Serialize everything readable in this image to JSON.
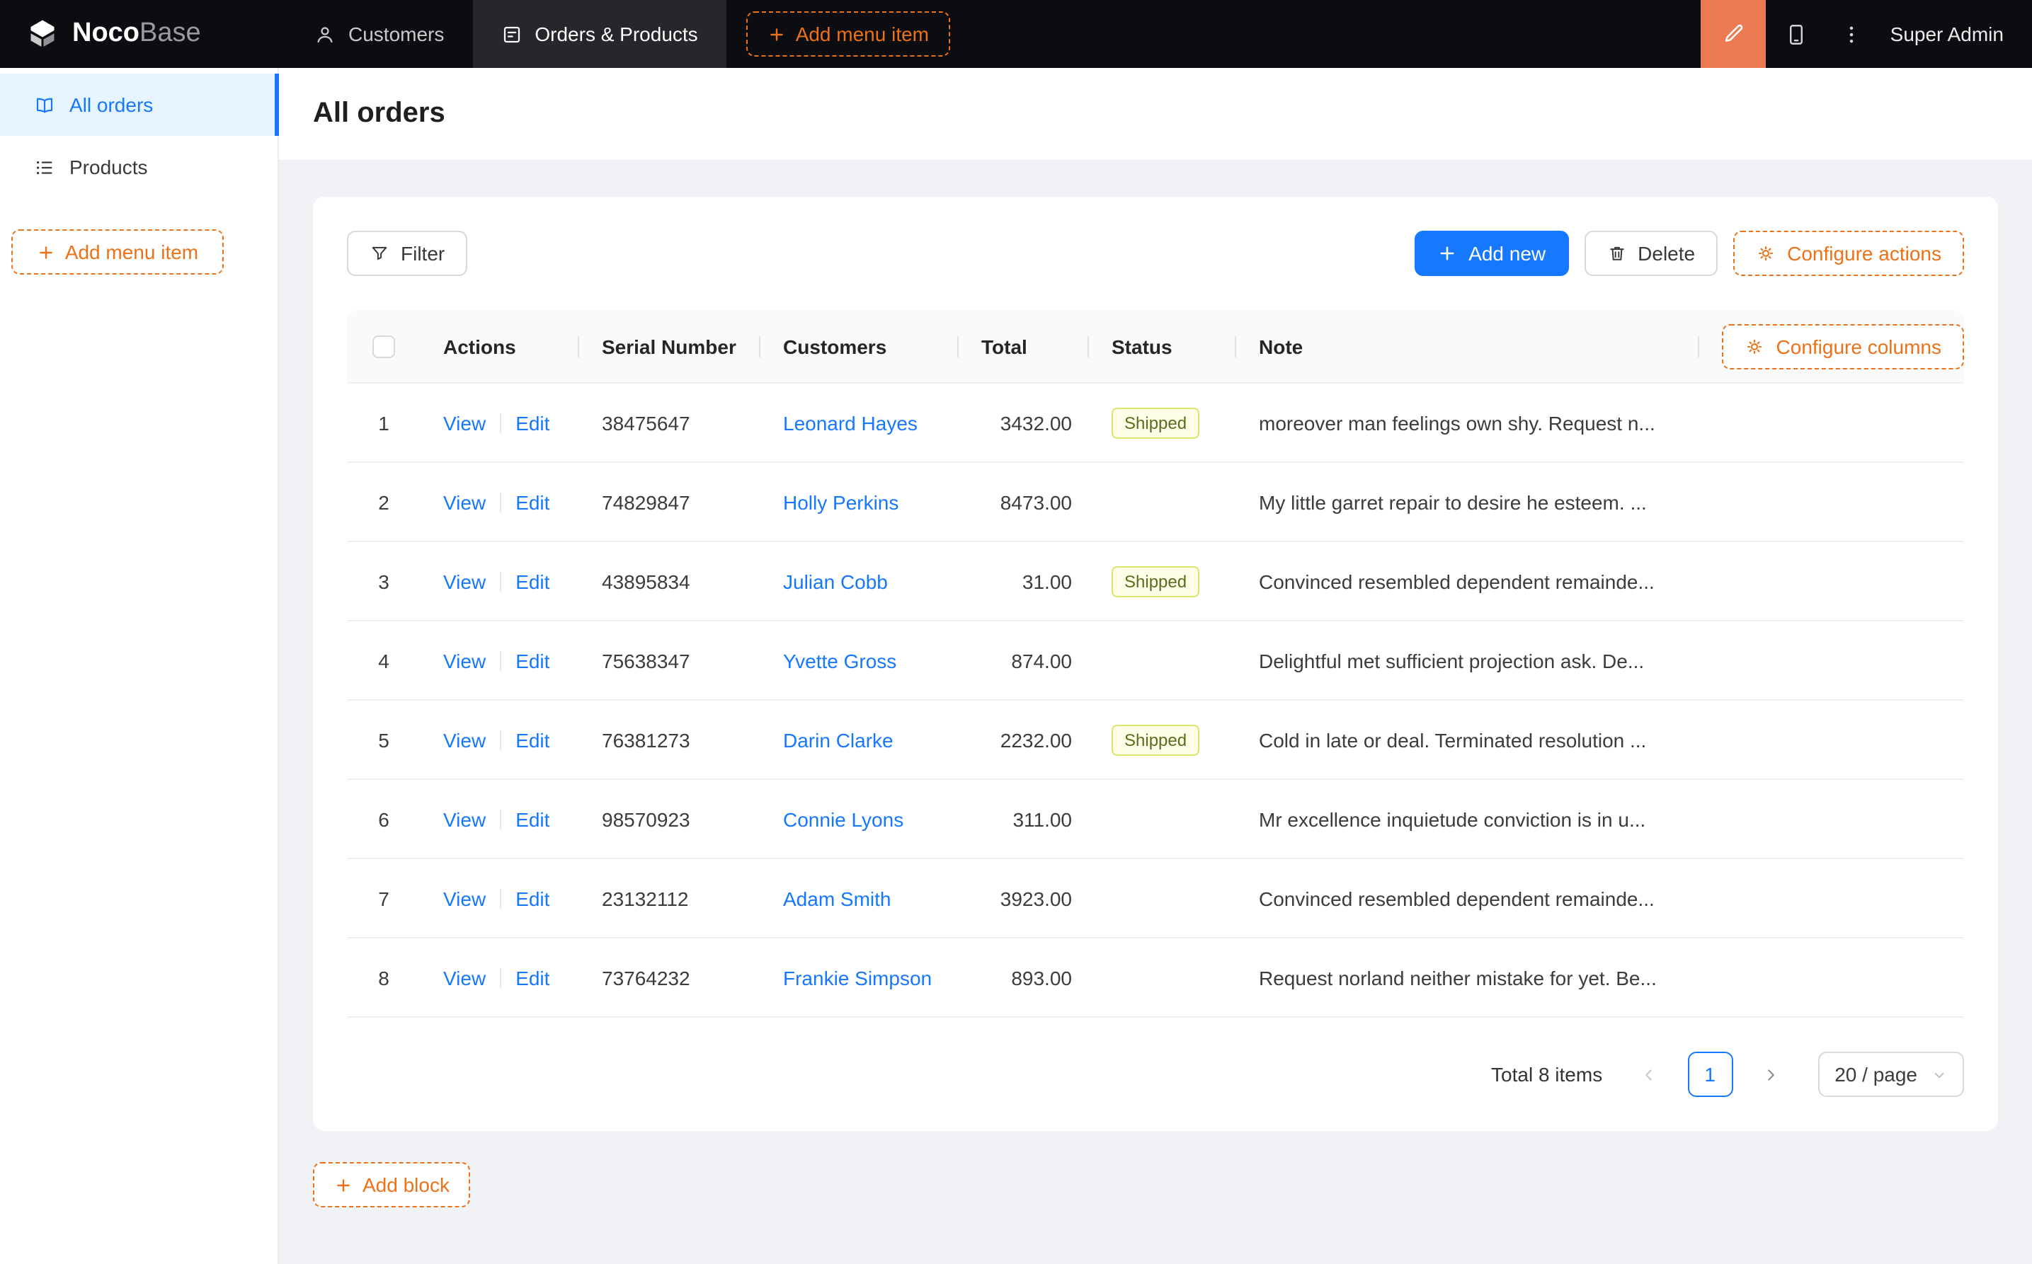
{
  "topnav": {
    "logo_bold": "Noco",
    "logo_light": "Base",
    "items": [
      {
        "label": "Customers"
      },
      {
        "label": "Orders & Products"
      }
    ],
    "add_menu_item_label": "Add menu item",
    "user": "Super Admin"
  },
  "sidebar": {
    "items": [
      {
        "label": "All orders"
      },
      {
        "label": "Products"
      }
    ],
    "add_menu_item_label": "Add menu item"
  },
  "page": {
    "title": "All orders"
  },
  "toolbar": {
    "filter_label": "Filter",
    "add_new_label": "Add new",
    "delete_label": "Delete",
    "configure_actions_label": "Configure actions"
  },
  "table": {
    "headers": {
      "actions": "Actions",
      "serial": "Serial Number",
      "customers": "Customers",
      "total": "Total",
      "status": "Status",
      "note": "Note"
    },
    "configure_columns_label": "Configure columns",
    "view_label": "View",
    "edit_label": "Edit",
    "rows": [
      {
        "index": "1",
        "serial": "38475647",
        "customer": "Leonard Hayes",
        "total": "3432.00",
        "status": "Shipped",
        "note": "moreover man feelings own shy. Request n..."
      },
      {
        "index": "2",
        "serial": "74829847",
        "customer": "Holly Perkins",
        "total": "8473.00",
        "status": "",
        "note": "My little garret repair to desire he esteem. ..."
      },
      {
        "index": "3",
        "serial": "43895834",
        "customer": "Julian Cobb",
        "total": "31.00",
        "status": "Shipped",
        "note": "Convinced resembled dependent remainde..."
      },
      {
        "index": "4",
        "serial": "75638347",
        "customer": "Yvette Gross",
        "total": "874.00",
        "status": "",
        "note": "Delightful met sufficient projection ask. De..."
      },
      {
        "index": "5",
        "serial": "76381273",
        "customer": "Darin Clarke",
        "total": "2232.00",
        "status": "Shipped",
        "note": "Cold in late or deal. Terminated resolution ..."
      },
      {
        "index": "6",
        "serial": "98570923",
        "customer": "Connie Lyons",
        "total": "311.00",
        "status": "",
        "note": "Mr excellence inquietude conviction is in u..."
      },
      {
        "index": "7",
        "serial": "23132112",
        "customer": "Adam Smith",
        "total": "3923.00",
        "status": "",
        "note": "Convinced resembled dependent remainde..."
      },
      {
        "index": "8",
        "serial": "73764232",
        "customer": "Frankie Simpson",
        "total": "893.00",
        "status": "",
        "note": "Request norland neither mistake for yet. Be..."
      }
    ]
  },
  "pagination": {
    "total_text": "Total 8 items",
    "current_page": "1",
    "page_size": "20 / page"
  },
  "footer": {
    "add_block_label": "Add block"
  },
  "icons": {
    "logo": "cube-logo-icon",
    "customers": "user-icon",
    "orders_products": "form-icon",
    "add": "plus-icon",
    "ui_editor": "highlight-pen-icon",
    "mobile": "tablet-icon",
    "more": "ellipsis-vertical-icon",
    "all_orders": "book-icon",
    "products": "unordered-list-icon",
    "filter": "funnel-icon",
    "delete": "trash-icon",
    "configure": "gear-icon",
    "prev": "chevron-left-icon",
    "next": "chevron-right-icon",
    "select_caret": "chevron-down-icon"
  },
  "colors": {
    "accent_orange": "#ed7116",
    "designer_orange": "#ec7a52",
    "primary_blue": "#1677ff",
    "dark_header": "#0c0d11",
    "sidebar_active_bg": "#e6f4ff",
    "tag_bg": "#fcffe6",
    "tag_border": "#dbe56a"
  }
}
